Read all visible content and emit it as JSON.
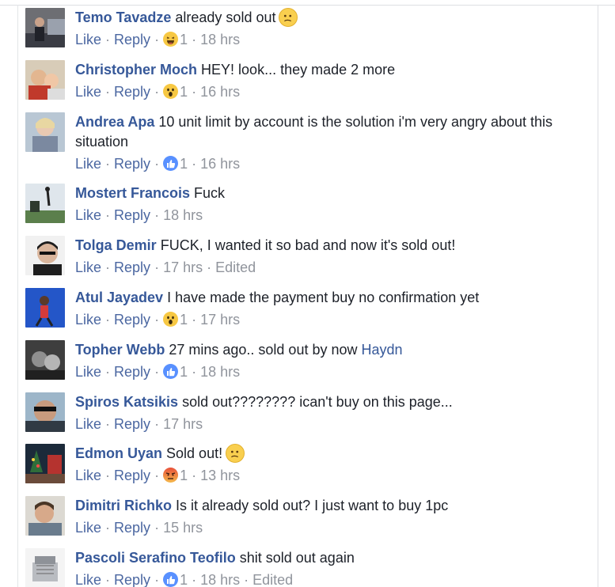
{
  "separator": "·",
  "comments": [
    {
      "author": "Temo Tavadze",
      "text": "already sold out",
      "emoji": "confused-face",
      "like": "Like",
      "reply": "Reply",
      "reaction": "haha",
      "count": "1",
      "time": "18 hrs",
      "edited": ""
    },
    {
      "author": "Christopher Moch",
      "text": "HEY! look... they made 2 more",
      "emoji": "",
      "like": "Like",
      "reply": "Reply",
      "reaction": "wow",
      "count": "1",
      "time": "16 hrs",
      "edited": ""
    },
    {
      "author": "Andrea Apa",
      "text": "10 unit limit by account is the solution i'm very angry about this situation",
      "emoji": "",
      "like": "Like",
      "reply": "Reply",
      "reaction": "like",
      "count": "1",
      "time": "16 hrs",
      "edited": ""
    },
    {
      "author": "Mostert Francois",
      "text": "Fuck",
      "emoji": "",
      "like": "Like",
      "reply": "Reply",
      "reaction": "",
      "count": "",
      "time": "18 hrs",
      "edited": ""
    },
    {
      "author": "Tolga Demir",
      "text": "FUCK, I wanted it so bad and now it's sold out!",
      "emoji": "",
      "like": "Like",
      "reply": "Reply",
      "reaction": "",
      "count": "",
      "time": "17 hrs",
      "edited": "Edited"
    },
    {
      "author": "Atul Jayadev",
      "text": "I have made the payment buy no confirmation yet",
      "emoji": "",
      "like": "Like",
      "reply": "Reply",
      "reaction": "wow",
      "count": "1",
      "time": "17 hrs",
      "edited": ""
    },
    {
      "author": "Topher Webb",
      "text": "27 mins ago.. sold out by now",
      "mention": "Haydn",
      "emoji": "",
      "like": "Like",
      "reply": "Reply",
      "reaction": "like",
      "count": "1",
      "time": "18 hrs",
      "edited": ""
    },
    {
      "author": "Spiros Katsikis",
      "text": "sold out???????? ican't buy on this page...",
      "emoji": "",
      "like": "Like",
      "reply": "Reply",
      "reaction": "",
      "count": "",
      "time": "17 hrs",
      "edited": ""
    },
    {
      "author": "Edmon Uyan",
      "text": "Sold out!",
      "emoji": "confused-face",
      "like": "Like",
      "reply": "Reply",
      "reaction": "angry",
      "count": "1",
      "time": "13 hrs",
      "edited": ""
    },
    {
      "author": "Dimitri Richko",
      "text": "Is it already sold out? I just want to buy 1pc",
      "emoji": "",
      "like": "Like",
      "reply": "Reply",
      "reaction": "",
      "count": "",
      "time": "15 hrs",
      "edited": ""
    },
    {
      "author": "Pascoli Serafino Teofilo",
      "text": "shit sold out again",
      "emoji": "",
      "like": "Like",
      "reply": "Reply",
      "reaction": "like",
      "count": "1",
      "time": "18 hrs",
      "edited": "Edited"
    }
  ]
}
